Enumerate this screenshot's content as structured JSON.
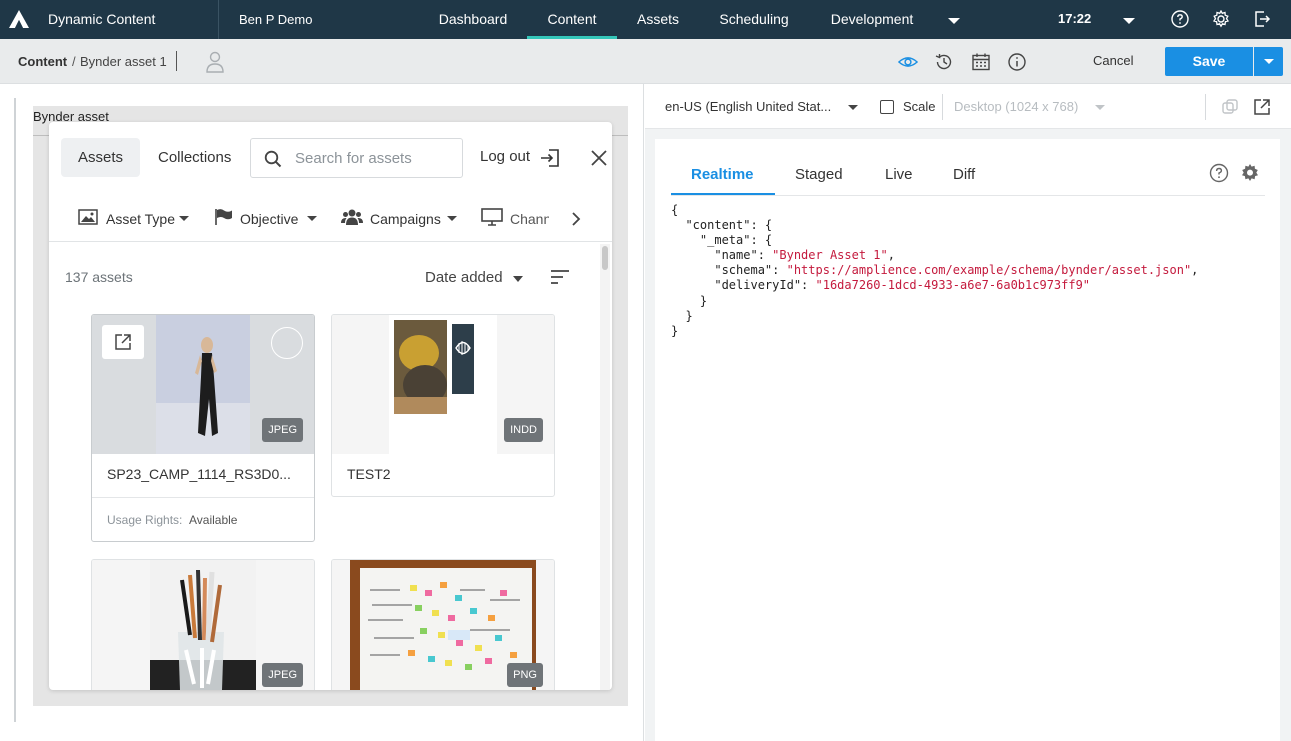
{
  "topbar": {
    "app_title": "Dynamic Content",
    "hub": "Ben P Demo",
    "nav": [
      "Dashboard",
      "Content",
      "Assets",
      "Scheduling",
      "Development"
    ],
    "active_nav": "Content",
    "time": "17:22"
  },
  "subbar": {
    "breadcrumb_root": "Content",
    "breadcrumb_sep": "/",
    "breadcrumb_leaf": "Bynder asset 1",
    "cancel_label": "Cancel",
    "save_label": "Save"
  },
  "form": {
    "field_label": "Bynder asset"
  },
  "bynder": {
    "tabs": [
      "Assets",
      "Collections"
    ],
    "search_placeholder": "Search for assets",
    "logout_label": "Log out",
    "filters": [
      "Asset Type",
      "Objective",
      "Campaigns",
      "Chann"
    ],
    "asset_count": "137 assets",
    "sort_label": "Date added",
    "assets": [
      {
        "name": "SP23_CAMP_1114_RS3D0...",
        "type": "JPEG",
        "rights_label": "Usage Rights:",
        "rights_value": "Available"
      },
      {
        "name": "TEST2",
        "type": "INDD"
      },
      {
        "name": "",
        "type": "JPEG"
      },
      {
        "name": "",
        "type": "PNG"
      }
    ]
  },
  "preview": {
    "locale": "en-US (English United Stat...",
    "scale_label": "Scale",
    "device": "Desktop (1024 x 768)",
    "tabs": [
      "Realtime",
      "Staged",
      "Live",
      "Diff"
    ],
    "active_tab": "Realtime",
    "json": {
      "l1": "{",
      "l2": "  \"content\": {",
      "l3": "    \"_meta\": {",
      "l4_key": "      \"name\": ",
      "l4_val": "\"Bynder Asset 1\"",
      "l5_key": "      \"schema\": ",
      "l5_val": "\"https://amplience.com/example/schema/bynder/asset.json\"",
      "l6_key": "      \"deliveryId\": ",
      "l6_val": "\"16da7260-1dcd-4933-a6e7-6a0b1c973ff9\"",
      "l7": "    }",
      "l8": "  }",
      "l9": "}"
    }
  },
  "colors": {
    "topbar_bg": "#1f3747",
    "active_nav_underline": "#34c6b9",
    "primary": "#1a8fe3",
    "json_string": "#c41a3d"
  },
  "icons": [
    "amplience-logo-icon",
    "chevron-down-icon",
    "help-icon",
    "gear-icon",
    "logout-icon",
    "user-icon",
    "eye-icon",
    "history-icon",
    "calendar-icon",
    "info-icon",
    "search-icon",
    "close-icon",
    "image-icon",
    "flag-icon",
    "users-icon",
    "monitor-icon",
    "chevron-right-icon",
    "sort-icon",
    "open-external-icon",
    "copy-icon"
  ]
}
